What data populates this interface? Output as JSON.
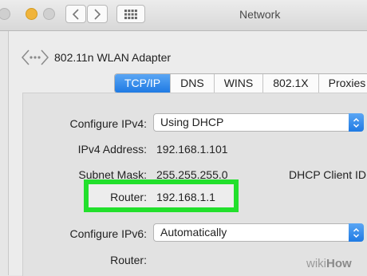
{
  "window": {
    "title": "Network"
  },
  "adapter": {
    "name": "802.11n WLAN Adapter"
  },
  "tabs": [
    {
      "label": "TCP/IP",
      "active": true
    },
    {
      "label": "DNS"
    },
    {
      "label": "WINS"
    },
    {
      "label": "802.1X"
    },
    {
      "label": "Proxies"
    }
  ],
  "form": {
    "configure_ipv4_label": "Configure IPv4:",
    "configure_ipv4_value": "Using DHCP",
    "ipv4_address_label": "IPv4 Address:",
    "ipv4_address_value": "192.168.1.101",
    "subnet_mask_label": "Subnet Mask:",
    "subnet_mask_value": "255.255.255.0",
    "dhcp_client_id_label": "DHCP Client ID",
    "router_label": "Router:",
    "router_value": "192.168.1.1",
    "configure_ipv6_label": "Configure IPv6:",
    "configure_ipv6_value": "Automatically",
    "router6_label": "Router:"
  },
  "highlight_color": "#22e02c",
  "accent_color": "#1f7ae3",
  "watermark": "wikiHow"
}
